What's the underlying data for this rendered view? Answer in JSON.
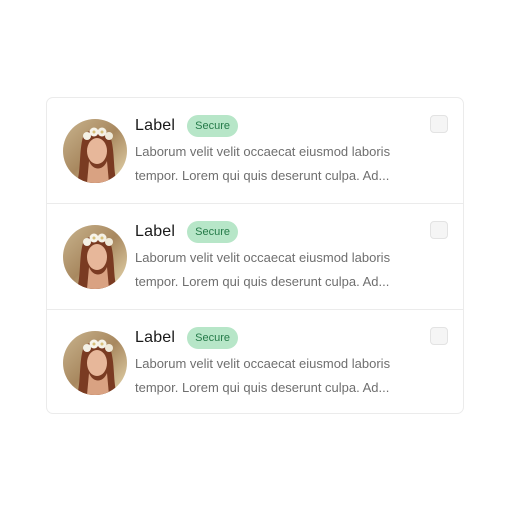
{
  "list": {
    "items": [
      {
        "label": "Label",
        "badge": "Secure",
        "line1": "Laborum velit velit occaecat eiusmod laboris",
        "line2": "tempor. Lorem qui quis deserunt culpa. Ad...",
        "checked": false
      },
      {
        "label": "Label",
        "badge": "Secure",
        "line1": "Laborum velit velit occaecat eiusmod laboris",
        "line2": "tempor. Lorem qui quis deserunt culpa. Ad...",
        "checked": false
      },
      {
        "label": "Label",
        "badge": "Secure",
        "line1": "Laborum velit velit occaecat eiusmod laboris",
        "line2": "tempor. Lorem qui quis deserunt culpa. Ad...",
        "checked": false
      }
    ]
  },
  "colors": {
    "badge_bg": "#b7e6c8",
    "badge_text": "#247a48",
    "border": "#ebebeb"
  }
}
